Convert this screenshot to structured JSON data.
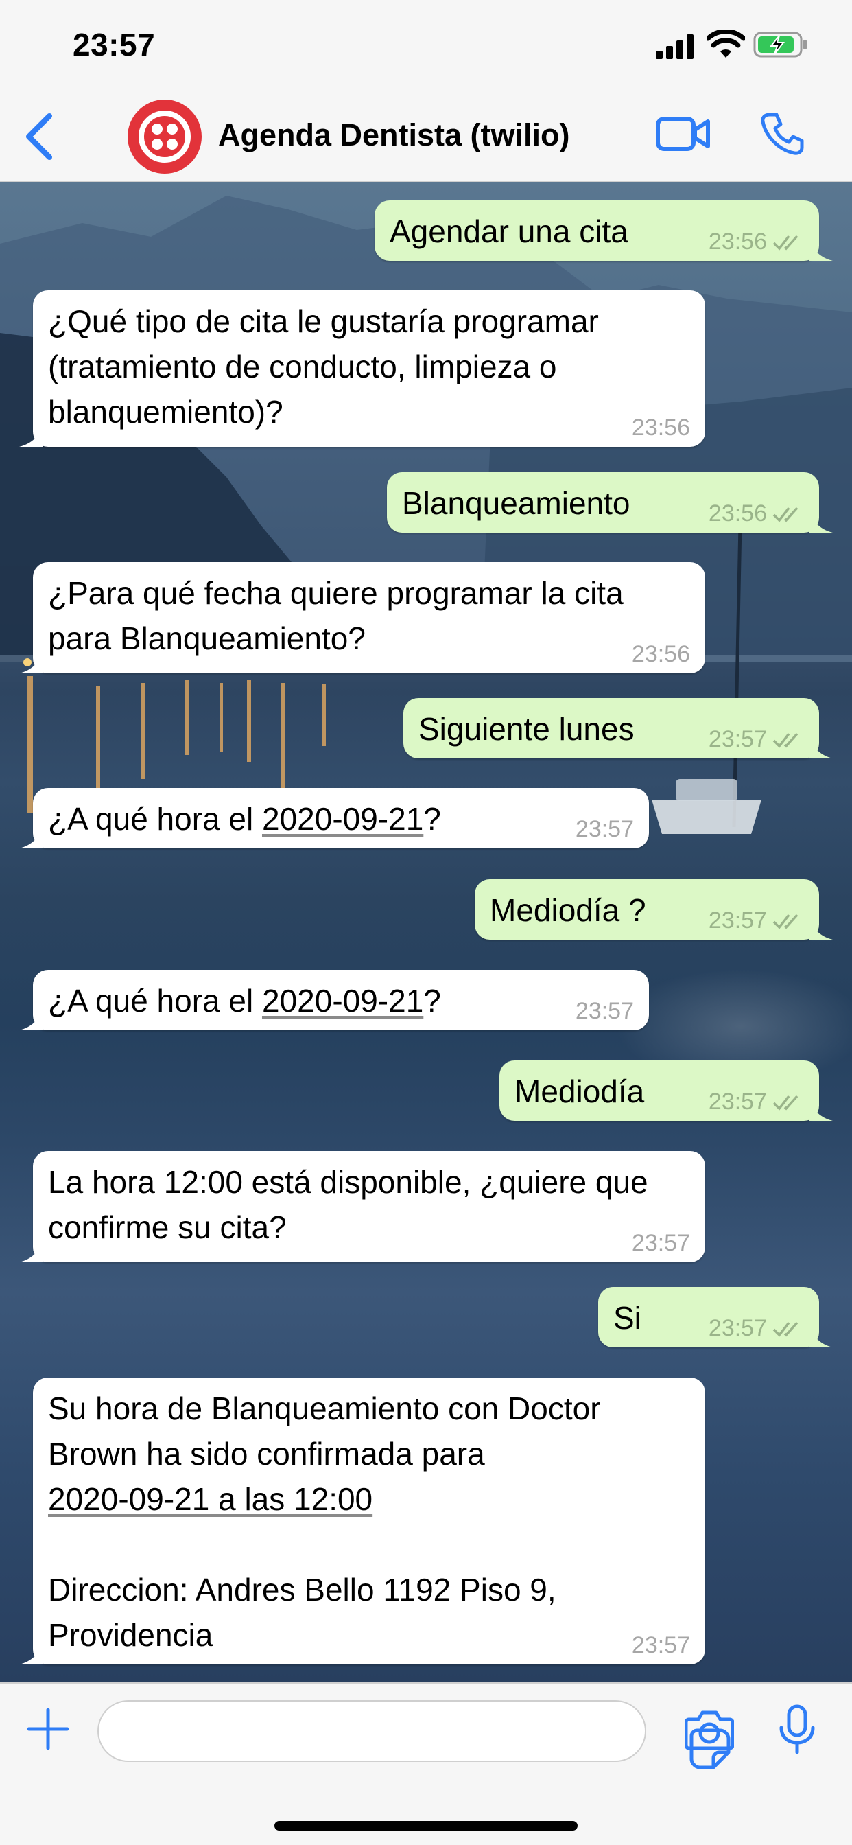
{
  "status_bar": {
    "time": "23:57"
  },
  "header": {
    "title": "Agenda Dentista (twilio)",
    "icons": {
      "back": "chevron-left-icon",
      "avatar": "twilio-logo",
      "video": "video-camera-icon",
      "phone": "phone-icon"
    }
  },
  "messages": [
    {
      "direction": "out",
      "text": "Agendar una cita",
      "time": "23:56",
      "status": "read"
    },
    {
      "direction": "in",
      "text": "¿Qué tipo de cita le gustaría programar (tratamiento de conducto, limpieza o blanquemiento)?",
      "time": "23:56"
    },
    {
      "direction": "out",
      "text": "Blanqueamiento",
      "time": "23:56",
      "status": "read"
    },
    {
      "direction": "in",
      "text": "¿Para qué fecha quiere programar la cita para Blanqueamiento?",
      "time": "23:56"
    },
    {
      "direction": "out",
      "text": "Siguiente lunes",
      "time": "23:57",
      "status": "read"
    },
    {
      "direction": "in",
      "text_before": "¿A qué hora el ",
      "link": "2020-09-21",
      "text_after": "?",
      "time": "23:57"
    },
    {
      "direction": "out",
      "text": "Mediodía ?",
      "time": "23:57",
      "status": "read"
    },
    {
      "direction": "in",
      "text_before": "¿A qué hora el ",
      "link": "2020-09-21",
      "text_after": "?",
      "time": "23:57"
    },
    {
      "direction": "out",
      "text": "Mediodía",
      "time": "23:57",
      "status": "read"
    },
    {
      "direction": "in",
      "text": "La hora 12:00 está disponible, ¿quiere que confirme su cita?",
      "time": "23:57"
    },
    {
      "direction": "out",
      "text": "Si",
      "time": "23:57",
      "status": "read"
    },
    {
      "direction": "in",
      "line1": "Su hora de Blanqueamiento con Doctor Brown ha sido confirmada para",
      "link": "2020-09-21 a las 12:00",
      "address": "Direccion: Andres Bello 1192 Piso 9, Providencia",
      "time": "23:57"
    }
  ],
  "composer": {
    "placeholder": "",
    "icons": {
      "add": "plus-icon",
      "sticker": "sticker-icon",
      "camera": "camera-icon",
      "mic": "microphone-icon"
    }
  },
  "colors": {
    "accent": "#2f7df6",
    "outgoing_bubble": "#dcf8c6",
    "incoming_bubble": "#ffffff",
    "avatar": "#e2333a",
    "read_ticks": "#9ab48a"
  }
}
